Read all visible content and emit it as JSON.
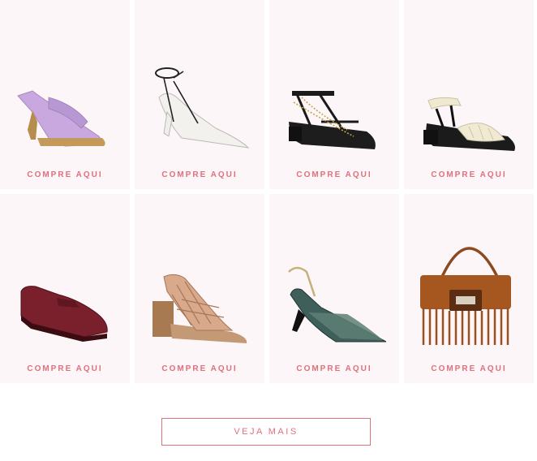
{
  "products": [
    {
      "name": "lilac-mule-sandal-icon",
      "cta": "COMPRE AQUI"
    },
    {
      "name": "white-pointed-ankle-strap-pump-icon",
      "cta": "COMPRE AQUI"
    },
    {
      "name": "black-chain-block-heel-sandal-icon",
      "cta": "COMPRE AQUI"
    },
    {
      "name": "cream-braided-strap-sandal-icon",
      "cta": "COMPRE AQUI"
    },
    {
      "name": "burgundy-loafer-icon",
      "cta": "COMPRE AQUI"
    },
    {
      "name": "tan-woven-block-heel-sandal-icon",
      "cta": "COMPRE AQUI"
    },
    {
      "name": "green-snake-slingback-pump-icon",
      "cta": "COMPRE AQUI"
    },
    {
      "name": "brown-fringe-shoulder-bag-icon",
      "cta": "COMPRE AQUI"
    }
  ],
  "more_button": {
    "label": "VEJA MAIS"
  },
  "colors": {
    "accent": "#e0707c",
    "card_bg": "#fdf6f8"
  }
}
